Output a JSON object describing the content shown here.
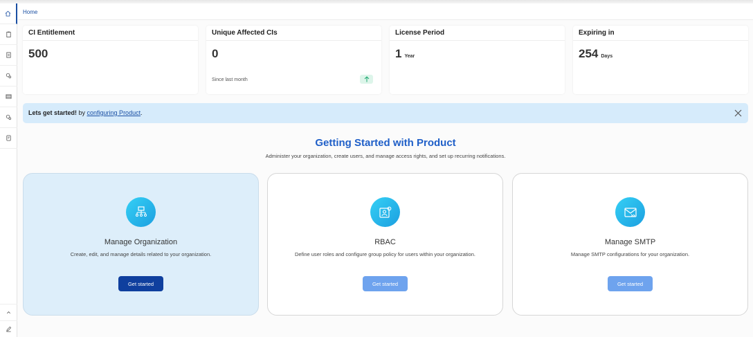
{
  "breadcrumb": {
    "home": "Home"
  },
  "sidebar": {
    "items": [
      {
        "icon": "home-icon",
        "active": true
      },
      {
        "icon": "clipboard-icon"
      },
      {
        "icon": "document-icon"
      },
      {
        "icon": "settings-search-icon"
      },
      {
        "icon": "table-icon"
      },
      {
        "icon": "settings-search-icon"
      },
      {
        "icon": "report-icon"
      }
    ],
    "bottom": [
      {
        "icon": "collapse-up-icon"
      },
      {
        "icon": "edit-icon"
      }
    ]
  },
  "stats": [
    {
      "title": "CI Entitlement",
      "value": "500",
      "unit": "",
      "sub": ""
    },
    {
      "title": "Unique Affected CIs",
      "value": "0",
      "unit": "",
      "sub": "Since last month",
      "trend": "up-arrow-icon"
    },
    {
      "title": "License Period",
      "value": "1",
      "unit": "Year",
      "sub": ""
    },
    {
      "title": "Expiring in",
      "value": "254",
      "unit": "Days",
      "sub": ""
    }
  ],
  "banner": {
    "bold": "Lets get started!",
    "text": " by ",
    "link": "configuring Product",
    "end": "."
  },
  "getting_started": {
    "title": "Getting Started with Product",
    "subtitle": "Administer your organization, create users, and manage access rights, and set up recurring notifications."
  },
  "features": [
    {
      "title": "Manage Organization",
      "desc": "Create, edit, and manage details related to your organization.",
      "button": "Get started",
      "icon": "organization-icon"
    },
    {
      "title": "RBAC",
      "desc": "Define user roles and configure group policy for users within your organization.",
      "button": "Get started",
      "icon": "user-settings-icon"
    },
    {
      "title": "Manage SMTP",
      "desc": "Manage SMTP configurations for your organization.",
      "button": "Get started",
      "icon": "mail-forward-icon"
    }
  ],
  "colors": {
    "accent": "#1f5fc8",
    "primary_button": "#0f3f9e",
    "secondary_button": "#6ea3ee",
    "banner_bg": "#d6ebfb"
  }
}
